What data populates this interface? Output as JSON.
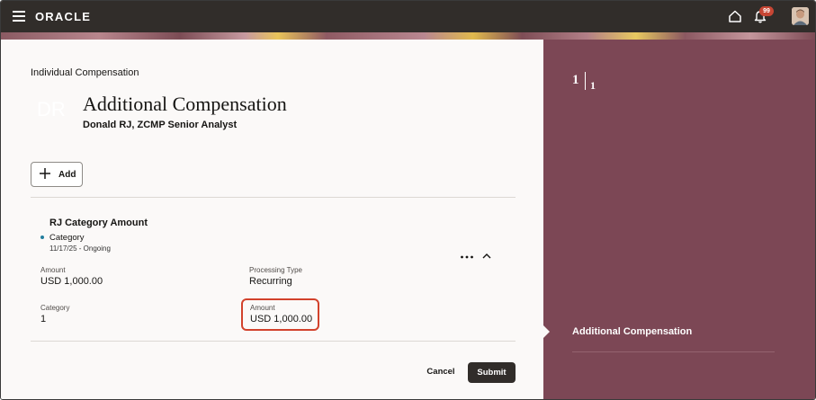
{
  "header": {
    "brand": "ORACLE",
    "notification_count": "99",
    "icons": [
      "hamburger-icon",
      "home-icon",
      "bell-icon",
      "avatar"
    ]
  },
  "page": {
    "section_title": "Individual Compensation",
    "initials": "DR",
    "title": "Additional Compensation",
    "subtitle": "Donald RJ, ZCMP Senior Analyst",
    "add_label": "Add"
  },
  "item": {
    "title": "RJ Category Amount",
    "category_label": "Category",
    "dates": "11/17/25 - Ongoing",
    "fields": [
      {
        "label": "Amount",
        "value": "USD 1,000.00"
      },
      {
        "label": "Processing Type",
        "value": "Recurring"
      },
      {
        "label": "Category",
        "value": "1"
      },
      {
        "label": "Amount",
        "value": "USD 1,000.00"
      }
    ]
  },
  "actions": {
    "cancel": "Cancel",
    "submit": "Submit"
  },
  "side": {
    "step_current": "1",
    "step_total": "1",
    "steps": [
      "Additional Compensation"
    ]
  },
  "colors": {
    "topbar": "#312d2a",
    "side_panel": "#7c4755",
    "highlight": "#d2422c",
    "badge": "#c74634"
  }
}
